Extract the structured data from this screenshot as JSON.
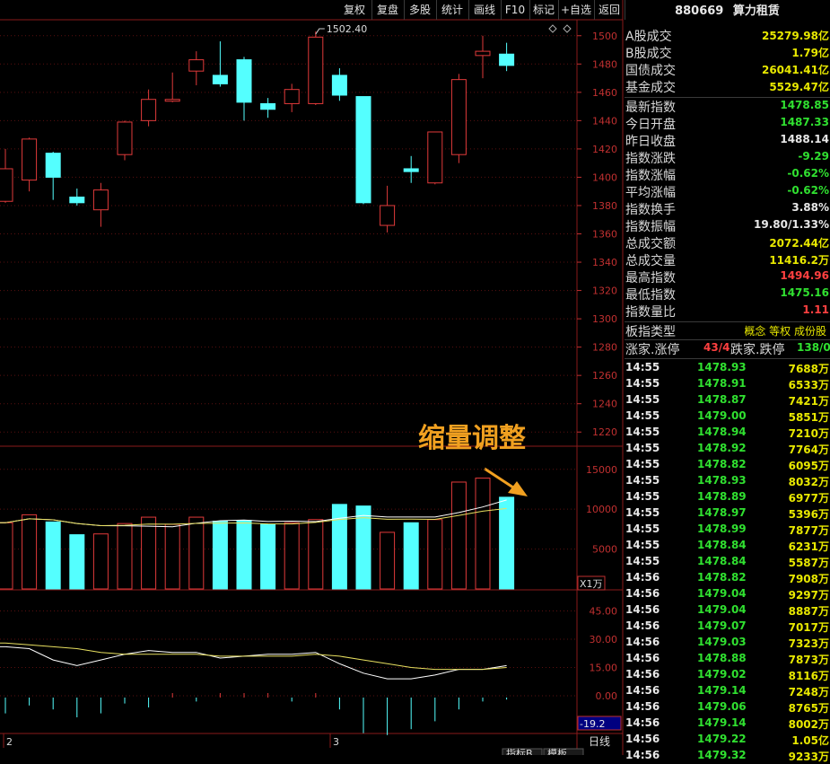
{
  "toolbar": [
    "复权",
    "复盘",
    "多股",
    "统计",
    "画线",
    "F10",
    "标记",
    "+自选",
    "返回"
  ],
  "chart": {
    "y_ticks": [
      "1500",
      "1480",
      "1460",
      "1440",
      "1420",
      "1400",
      "1380",
      "1360",
      "1340",
      "1320",
      "1300",
      "1280",
      "1260",
      "1240",
      "1220"
    ],
    "max_label": "1502.40",
    "annotation": "缩量调整",
    "vol_ticks": [
      "15000",
      "10000",
      "5000"
    ],
    "vol_unit": "X1万",
    "ind_ticks": [
      "45.00",
      "30.00",
      "15.00",
      "0.00"
    ],
    "ind_value": "-19.2",
    "x_labels": [
      "2",
      "3"
    ],
    "period": "日线",
    "bottom_tabs": [
      "指标B",
      "模板"
    ]
  },
  "chart_data": {
    "type": "candlestick",
    "candles": [
      {
        "o": 1383,
        "h": 1420,
        "l": 1382,
        "c": 1406
      },
      {
        "o": 1398,
        "h": 1428,
        "l": 1390,
        "c": 1427
      },
      {
        "o": 1417,
        "h": 1418,
        "l": 1384,
        "c": 1400
      },
      {
        "o": 1386,
        "h": 1392,
        "l": 1380,
        "c": 1382
      },
      {
        "o": 1377,
        "h": 1396,
        "l": 1365,
        "c": 1391
      },
      {
        "o": 1416,
        "h": 1440,
        "l": 1412,
        "c": 1439
      },
      {
        "o": 1440,
        "h": 1462,
        "l": 1436,
        "c": 1455
      },
      {
        "o": 1454,
        "h": 1474,
        "l": 1453,
        "c": 1455
      },
      {
        "o": 1475,
        "h": 1489,
        "l": 1465,
        "c": 1483
      },
      {
        "o": 1472,
        "h": 1496,
        "l": 1464,
        "c": 1466
      },
      {
        "o": 1483,
        "h": 1485,
        "l": 1440,
        "c": 1453
      },
      {
        "o": 1452,
        "h": 1456,
        "l": 1442,
        "c": 1448
      },
      {
        "o": 1452,
        "h": 1466,
        "l": 1446,
        "c": 1462
      },
      {
        "o": 1452,
        "h": 1503,
        "l": 1451,
        "c": 1499
      },
      {
        "o": 1472,
        "h": 1477,
        "l": 1454,
        "c": 1458
      },
      {
        "o": 1457,
        "h": 1457,
        "l": 1381,
        "c": 1382
      },
      {
        "o": 1366,
        "h": 1394,
        "l": 1361,
        "c": 1380
      },
      {
        "o": 1406,
        "h": 1415,
        "l": 1396,
        "c": 1404
      },
      {
        "o": 1396,
        "h": 1432,
        "l": 1395,
        "c": 1432
      },
      {
        "o": 1416,
        "h": 1473,
        "l": 1410,
        "c": 1469
      },
      {
        "o": 1486,
        "h": 1500,
        "l": 1470,
        "c": 1489
      },
      {
        "o": 1487,
        "h": 1495,
        "l": 1475,
        "c": 1479
      }
    ],
    "volume": [
      8300,
      9300,
      8400,
      6800,
      6900,
      8200,
      9000,
      8100,
      9000,
      8500,
      8600,
      8100,
      8300,
      8700,
      10600,
      10400,
      7100,
      8300,
      8700,
      13400,
      13900,
      11500
    ],
    "volume_ylim": [
      0,
      17000
    ],
    "ylim": [
      1210,
      1510
    ]
  },
  "panel": {
    "code": "880669",
    "name": "算力租赁",
    "stats": [
      {
        "label": "A股成交",
        "value": "25279.98亿",
        "color": "#e8e800"
      },
      {
        "label": "B股成交",
        "value": "1.79亿",
        "color": "#e8e800"
      },
      {
        "label": "国债成交",
        "value": "26041.41亿",
        "color": "#e8e800"
      },
      {
        "label": "基金成交",
        "value": "5529.47亿",
        "color": "#e8e800"
      },
      {
        "label": "最新指数",
        "value": "1478.85",
        "color": "#30e030"
      },
      {
        "label": "今日开盘",
        "value": "1487.33",
        "color": "#30e030"
      },
      {
        "label": "昨日收盘",
        "value": "1488.14",
        "color": "#e8e8e8"
      },
      {
        "label": "指数涨跌",
        "value": "-9.29",
        "color": "#30e030"
      },
      {
        "label": "指数涨幅",
        "value": "-0.62%",
        "color": "#30e030"
      },
      {
        "label": "平均涨幅",
        "value": "-0.62%",
        "color": "#30e030"
      },
      {
        "label": "指数换手",
        "value": "3.88%",
        "color": "#e8e8e8"
      },
      {
        "label": "指数振幅",
        "value": "19.80/1.33%",
        "color": "#e8e8e8"
      },
      {
        "label": "总成交额",
        "value": "2072.44亿",
        "color": "#e8e800"
      },
      {
        "label": "总成交量",
        "value": "11416.2万",
        "color": "#e8e800"
      },
      {
        "label": "最高指数",
        "value": "1494.96",
        "color": "#ff4040"
      },
      {
        "label": "最低指数",
        "value": "1475.16",
        "color": "#30e030"
      },
      {
        "label": "指数量比",
        "value": "1.11",
        "color": "#ff4040"
      }
    ],
    "type_label": "板指类型",
    "type_value": "概念 等权 成份股",
    "up_label": "涨家.涨停",
    "up_value": "43/4",
    "down_label": "跌家.跌停",
    "down_value": "138/0",
    "ticks": [
      {
        "t": "14:55",
        "p": "1478.93",
        "v": "7688万"
      },
      {
        "t": "14:55",
        "p": "1478.91",
        "v": "6533万"
      },
      {
        "t": "14:55",
        "p": "1478.87",
        "v": "7421万"
      },
      {
        "t": "14:55",
        "p": "1479.00",
        "v": "5851万"
      },
      {
        "t": "14:55",
        "p": "1478.94",
        "v": "7210万"
      },
      {
        "t": "14:55",
        "p": "1478.92",
        "v": "7764万"
      },
      {
        "t": "14:55",
        "p": "1478.82",
        "v": "6095万"
      },
      {
        "t": "14:55",
        "p": "1478.93",
        "v": "8032万"
      },
      {
        "t": "14:55",
        "p": "1478.89",
        "v": "6977万"
      },
      {
        "t": "14:55",
        "p": "1478.97",
        "v": "5396万"
      },
      {
        "t": "14:55",
        "p": "1478.99",
        "v": "7877万"
      },
      {
        "t": "14:55",
        "p": "1478.84",
        "v": "6231万"
      },
      {
        "t": "14:55",
        "p": "1478.84",
        "v": "5587万"
      },
      {
        "t": "14:56",
        "p": "1478.82",
        "v": "7908万"
      },
      {
        "t": "14:56",
        "p": "1479.04",
        "v": "9297万"
      },
      {
        "t": "14:56",
        "p": "1479.04",
        "v": "8887万"
      },
      {
        "t": "14:56",
        "p": "1479.07",
        "v": "7017万"
      },
      {
        "t": "14:56",
        "p": "1479.03",
        "v": "7323万"
      },
      {
        "t": "14:56",
        "p": "1478.88",
        "v": "7873万"
      },
      {
        "t": "14:56",
        "p": "1479.02",
        "v": "8116万"
      },
      {
        "t": "14:56",
        "p": "1479.14",
        "v": "7248万"
      },
      {
        "t": "14:56",
        "p": "1479.06",
        "v": "8765万"
      },
      {
        "t": "14:56",
        "p": "1479.14",
        "v": "8002万"
      },
      {
        "t": "14:56",
        "p": "1479.22",
        "v": "1.05亿"
      },
      {
        "t": "14:56",
        "p": "1479.32",
        "v": "9233万"
      }
    ]
  }
}
